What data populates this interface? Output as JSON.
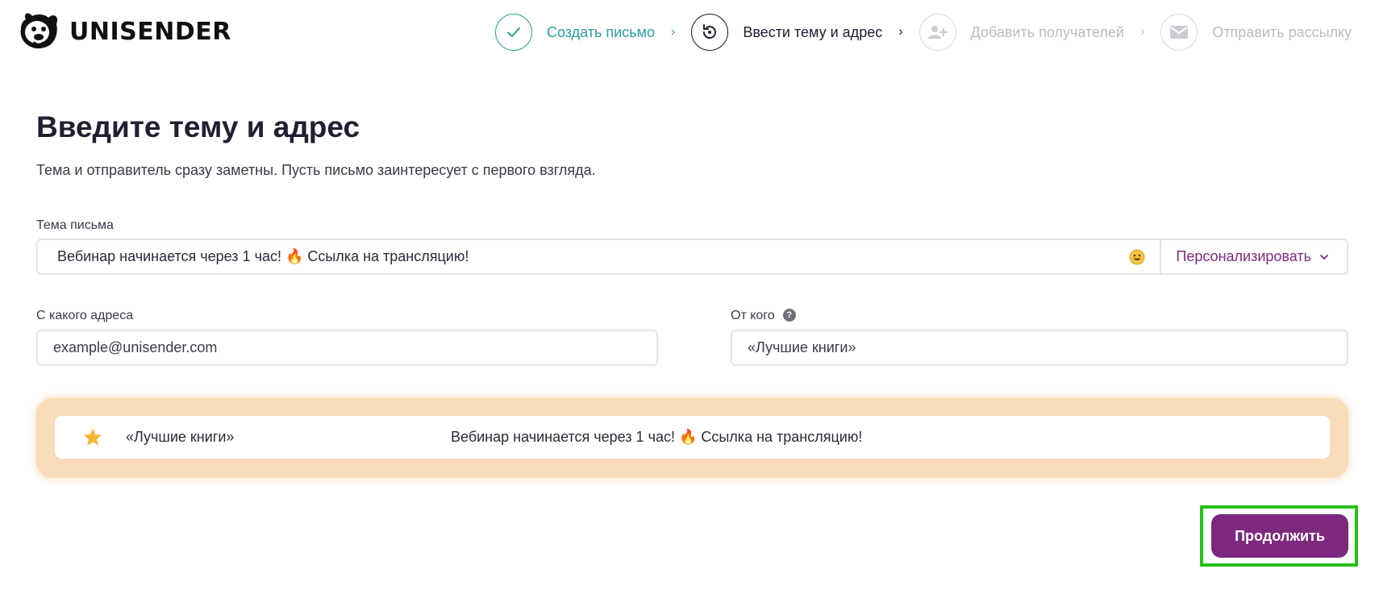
{
  "header": {
    "brand": "UNISENDER",
    "steps": [
      {
        "label": "Создать письмо",
        "state": "done",
        "icon": "check-icon"
      },
      {
        "label": "Ввести тему и адрес",
        "state": "active",
        "icon": "refresh-icon"
      },
      {
        "label": "Добавить получателей",
        "state": "todo",
        "icon": "add-users-icon"
      },
      {
        "label": "Отправить рассылку",
        "state": "todo",
        "icon": "envelope-icon"
      }
    ],
    "step_separator": "›"
  },
  "main": {
    "title": "Введите тему и адрес",
    "subtitle": "Тема и отправитель сразу заметны. Пусть письмо заинтересует с первого взгляда.",
    "subject": {
      "label": "Тема письма",
      "value": "Вебинар начинается через 1 час! 🔥 Ссылка на трансляцию!",
      "personalize_label": "Персонализировать"
    },
    "from_address": {
      "label": "С какого адреса",
      "value": "example@unisender.com"
    },
    "from_name": {
      "label": "От кого",
      "help": "?",
      "value": "«Лучшие книги»"
    },
    "preview": {
      "from": "«Лучшие книги»",
      "subject": "Вебинар начинается через 1 час! 🔥 Ссылка на трансляцию!"
    },
    "continue_label": "Продолжить"
  },
  "colors": {
    "accent": "#7d2a7e",
    "done": "#2a9da3",
    "preview_bg": "#f8dcb9",
    "highlight": "#24c115"
  }
}
